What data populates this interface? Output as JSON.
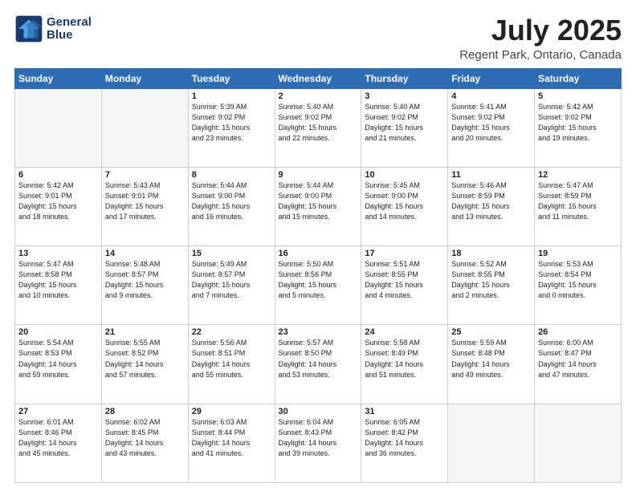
{
  "header": {
    "logo_line1": "General",
    "logo_line2": "Blue",
    "main_title": "July 2025",
    "subtitle": "Regent Park, Ontario, Canada"
  },
  "days_of_week": [
    "Sunday",
    "Monday",
    "Tuesday",
    "Wednesday",
    "Thursday",
    "Friday",
    "Saturday"
  ],
  "weeks": [
    [
      {
        "num": "",
        "info": ""
      },
      {
        "num": "",
        "info": ""
      },
      {
        "num": "1",
        "info": "Sunrise: 5:39 AM\nSunset: 9:02 PM\nDaylight: 15 hours\nand 23 minutes."
      },
      {
        "num": "2",
        "info": "Sunrise: 5:40 AM\nSunset: 9:02 PM\nDaylight: 15 hours\nand 22 minutes."
      },
      {
        "num": "3",
        "info": "Sunrise: 5:40 AM\nSunset: 9:02 PM\nDaylight: 15 hours\nand 21 minutes."
      },
      {
        "num": "4",
        "info": "Sunrise: 5:41 AM\nSunset: 9:02 PM\nDaylight: 15 hours\nand 20 minutes."
      },
      {
        "num": "5",
        "info": "Sunrise: 5:42 AM\nSunset: 9:02 PM\nDaylight: 15 hours\nand 19 minutes."
      }
    ],
    [
      {
        "num": "6",
        "info": "Sunrise: 5:42 AM\nSunset: 9:01 PM\nDaylight: 15 hours\nand 18 minutes."
      },
      {
        "num": "7",
        "info": "Sunrise: 5:43 AM\nSunset: 9:01 PM\nDaylight: 15 hours\nand 17 minutes."
      },
      {
        "num": "8",
        "info": "Sunrise: 5:44 AM\nSunset: 9:00 PM\nDaylight: 15 hours\nand 16 minutes."
      },
      {
        "num": "9",
        "info": "Sunrise: 5:44 AM\nSunset: 9:00 PM\nDaylight: 15 hours\nand 15 minutes."
      },
      {
        "num": "10",
        "info": "Sunrise: 5:45 AM\nSunset: 9:00 PM\nDaylight: 15 hours\nand 14 minutes."
      },
      {
        "num": "11",
        "info": "Sunrise: 5:46 AM\nSunset: 8:59 PM\nDaylight: 15 hours\nand 13 minutes."
      },
      {
        "num": "12",
        "info": "Sunrise: 5:47 AM\nSunset: 8:59 PM\nDaylight: 15 hours\nand 11 minutes."
      }
    ],
    [
      {
        "num": "13",
        "info": "Sunrise: 5:47 AM\nSunset: 8:58 PM\nDaylight: 15 hours\nand 10 minutes."
      },
      {
        "num": "14",
        "info": "Sunrise: 5:48 AM\nSunset: 8:57 PM\nDaylight: 15 hours\nand 9 minutes."
      },
      {
        "num": "15",
        "info": "Sunrise: 5:49 AM\nSunset: 8:57 PM\nDaylight: 15 hours\nand 7 minutes."
      },
      {
        "num": "16",
        "info": "Sunrise: 5:50 AM\nSunset: 8:56 PM\nDaylight: 15 hours\nand 5 minutes."
      },
      {
        "num": "17",
        "info": "Sunrise: 5:51 AM\nSunset: 8:55 PM\nDaylight: 15 hours\nand 4 minutes."
      },
      {
        "num": "18",
        "info": "Sunrise: 5:52 AM\nSunset: 8:55 PM\nDaylight: 15 hours\nand 2 minutes."
      },
      {
        "num": "19",
        "info": "Sunrise: 5:53 AM\nSunset: 8:54 PM\nDaylight: 15 hours\nand 0 minutes."
      }
    ],
    [
      {
        "num": "20",
        "info": "Sunrise: 5:54 AM\nSunset: 8:53 PM\nDaylight: 14 hours\nand 59 minutes."
      },
      {
        "num": "21",
        "info": "Sunrise: 5:55 AM\nSunset: 8:52 PM\nDaylight: 14 hours\nand 57 minutes."
      },
      {
        "num": "22",
        "info": "Sunrise: 5:56 AM\nSunset: 8:51 PM\nDaylight: 14 hours\nand 55 minutes."
      },
      {
        "num": "23",
        "info": "Sunrise: 5:57 AM\nSunset: 8:50 PM\nDaylight: 14 hours\nand 53 minutes."
      },
      {
        "num": "24",
        "info": "Sunrise: 5:58 AM\nSunset: 8:49 PM\nDaylight: 14 hours\nand 51 minutes."
      },
      {
        "num": "25",
        "info": "Sunrise: 5:59 AM\nSunset: 8:48 PM\nDaylight: 14 hours\nand 49 minutes."
      },
      {
        "num": "26",
        "info": "Sunrise: 6:00 AM\nSunset: 8:47 PM\nDaylight: 14 hours\nand 47 minutes."
      }
    ],
    [
      {
        "num": "27",
        "info": "Sunrise: 6:01 AM\nSunset: 8:46 PM\nDaylight: 14 hours\nand 45 minutes."
      },
      {
        "num": "28",
        "info": "Sunrise: 6:02 AM\nSunset: 8:45 PM\nDaylight: 14 hours\nand 43 minutes."
      },
      {
        "num": "29",
        "info": "Sunrise: 6:03 AM\nSunset: 8:44 PM\nDaylight: 14 hours\nand 41 minutes."
      },
      {
        "num": "30",
        "info": "Sunrise: 6:04 AM\nSunset: 8:43 PM\nDaylight: 14 hours\nand 39 minutes."
      },
      {
        "num": "31",
        "info": "Sunrise: 6:05 AM\nSunset: 8:42 PM\nDaylight: 14 hours\nand 36 minutes."
      },
      {
        "num": "",
        "info": ""
      },
      {
        "num": "",
        "info": ""
      }
    ]
  ]
}
